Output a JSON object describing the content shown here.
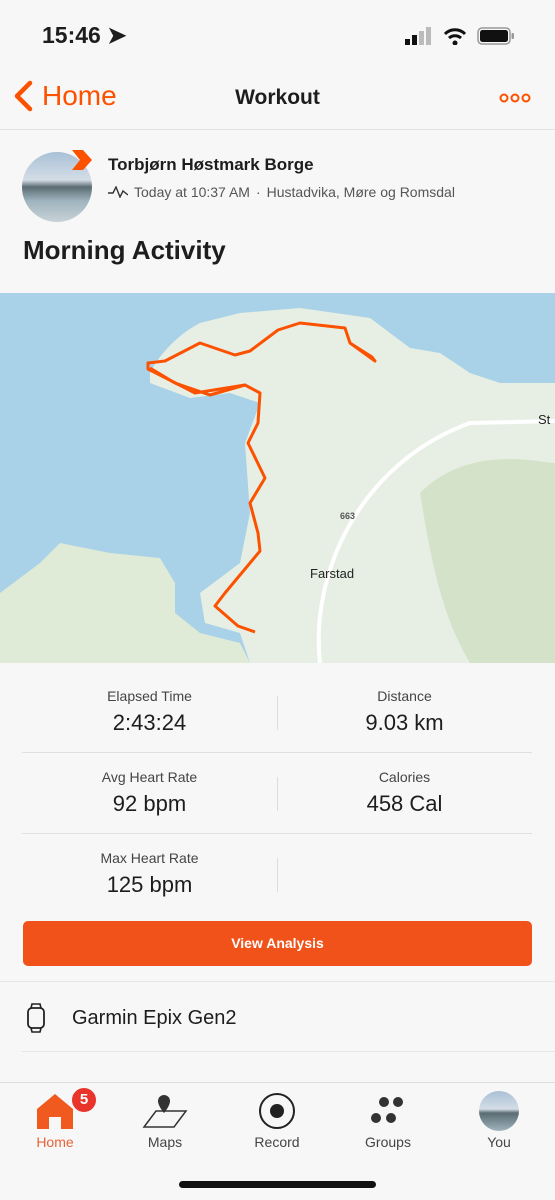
{
  "status_bar": {
    "time": "15:46"
  },
  "nav": {
    "back_label": "Home",
    "title": "Workout",
    "more_icon": "ellipsis-icon"
  },
  "athlete": {
    "name": "Torbjørn Høstmark Borge",
    "timestamp": "Today at 10:37 AM",
    "location": "Hustadvika, Møre og Romsdal",
    "separator": "·"
  },
  "activity": {
    "title": "Morning Activity"
  },
  "map": {
    "labels": {
      "town": "Farstad",
      "road": "663",
      "edge": "St"
    },
    "route_color": "#fc5200"
  },
  "stats": [
    [
      {
        "label": "Elapsed Time",
        "value": "2:43:24"
      },
      {
        "label": "Distance",
        "value": "9.03 km"
      }
    ],
    [
      {
        "label": "Avg Heart Rate",
        "value": "92 bpm"
      },
      {
        "label": "Calories",
        "value": "458 Cal"
      }
    ],
    [
      {
        "label": "Max Heart Rate",
        "value": "125 bpm"
      },
      {
        "label": "",
        "value": ""
      }
    ]
  ],
  "analysis_button": "View Analysis",
  "device": {
    "name": "Garmin Epix Gen2",
    "icon": "watch-icon"
  },
  "tabbar": {
    "items": [
      {
        "label": "Home",
        "badge": "5"
      },
      {
        "label": "Maps"
      },
      {
        "label": "Record"
      },
      {
        "label": "Groups"
      },
      {
        "label": "You"
      }
    ]
  },
  "colors": {
    "accent": "#fc5200",
    "button": "#f0521a",
    "badge": "#e8342a"
  }
}
